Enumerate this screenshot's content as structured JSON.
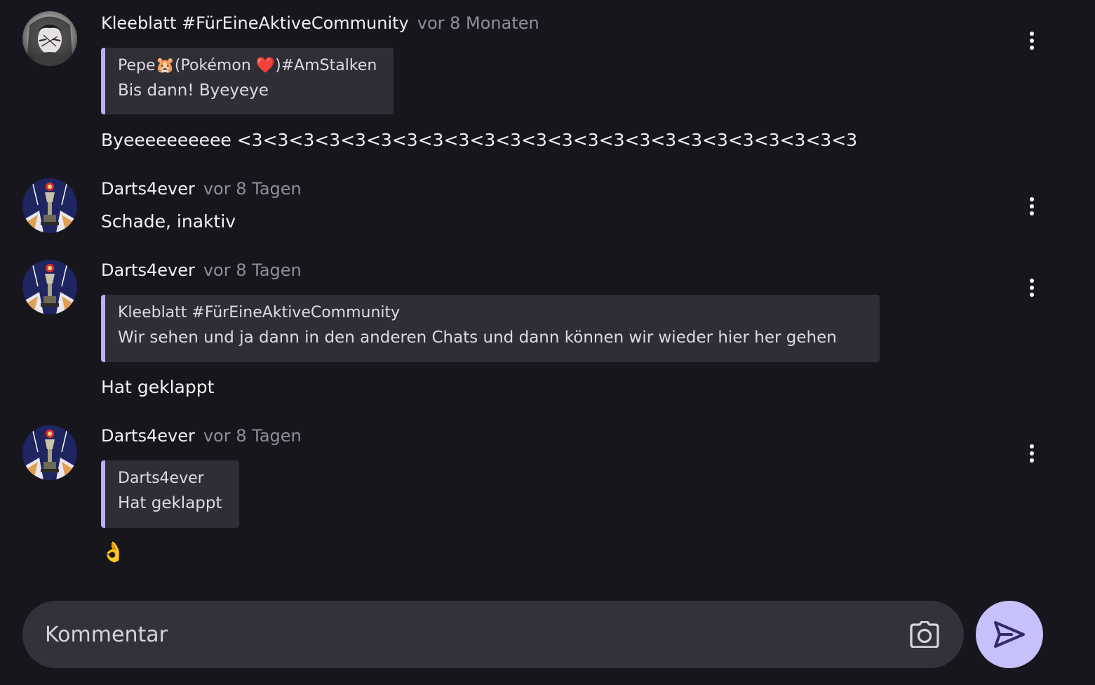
{
  "theme": {
    "background": "#17161d",
    "quote_accent": "#b5b0f7",
    "send_button": "#c6c1fb",
    "composer_background": "#33323a"
  },
  "comments": [
    {
      "author": "Kleeblatt #FürEineAktiveCommunity",
      "time": "vor 8 Monaten",
      "avatar": "anime-avatar",
      "quote": {
        "author": "Pepe🐹(Pokémon ❤️)#AmStalken",
        "text": "Bis dann! Byeyeye"
      },
      "text": "Byeeeeeeeeee <3<3<3<3<3<3<3<3<3<3<3<3<3<3<3<3<3<3<3<3<3<3<3<3",
      "more_icon": "more-vertical-icon"
    },
    {
      "author": "Darts4ever",
      "time": "vor 8 Tagen",
      "avatar": "darts-trophy-avatar",
      "text": "Schade, inaktiv",
      "more_icon": "more-vertical-icon"
    },
    {
      "author": "Darts4ever",
      "time": "vor 8 Tagen",
      "avatar": "darts-trophy-avatar",
      "quote": {
        "author": "Kleeblatt #FürEineAktiveCommunity",
        "text": "Wir sehen und ja dann in den anderen Chats und dann können wir wieder hier her gehen"
      },
      "text": "Hat geklappt",
      "more_icon": "more-vertical-icon"
    },
    {
      "author": "Darts4ever",
      "time": "vor 8 Tagen",
      "avatar": "darts-trophy-avatar",
      "quote": {
        "author": "Darts4ever",
        "text": "Hat geklappt"
      },
      "text": "👌",
      "more_icon": "more-vertical-icon"
    }
  ],
  "composer": {
    "placeholder": "Kommentar",
    "camera_icon": "camera-icon",
    "send_icon": "send-icon"
  }
}
